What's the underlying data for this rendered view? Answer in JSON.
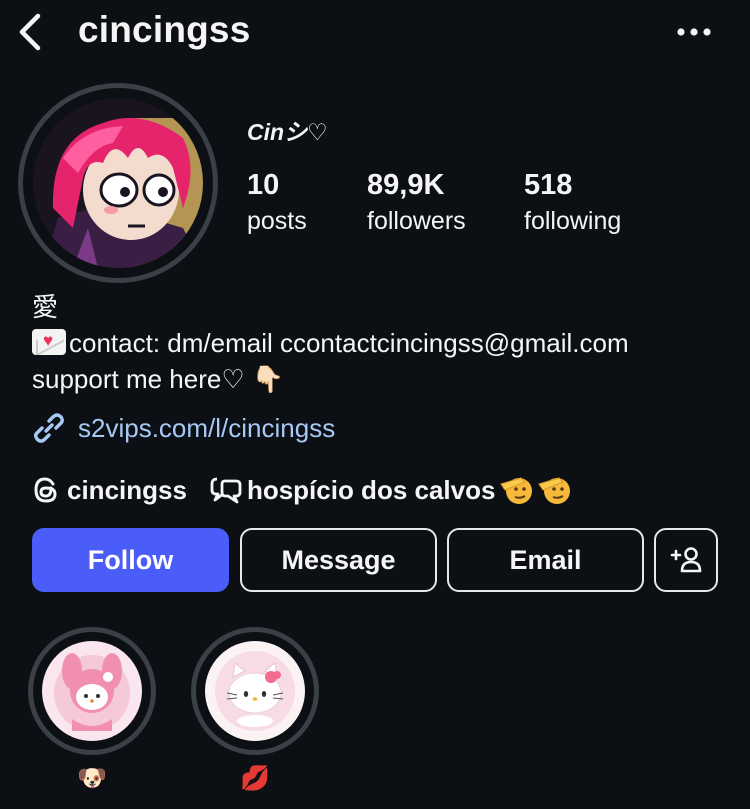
{
  "header": {
    "username": "cincingss"
  },
  "profile": {
    "display_name": "Cinシ♡",
    "stats": [
      {
        "value": "10",
        "label": "posts"
      },
      {
        "value": "89,9K",
        "label": "followers"
      },
      {
        "value": "518",
        "label": "following"
      }
    ]
  },
  "bio": {
    "line1": "愛",
    "line2": "contact: dm/email ccontactcincingss@gmail.com",
    "line3": "support me here♡ 👇🏻",
    "link": "s2vips.com/l/cincingss"
  },
  "social": {
    "threads_handle": "cincingss",
    "channel_name": "hospício dos calvos"
  },
  "buttons": {
    "follow": "Follow",
    "message": "Message",
    "email": "Email"
  },
  "highlights": [
    {
      "label": "🐶"
    },
    {
      "label": "💋"
    }
  ],
  "colors": {
    "background": "#0c1014",
    "follow_button": "#4a5df9",
    "link": "#a7c9f5",
    "ring": "#3b4046"
  }
}
